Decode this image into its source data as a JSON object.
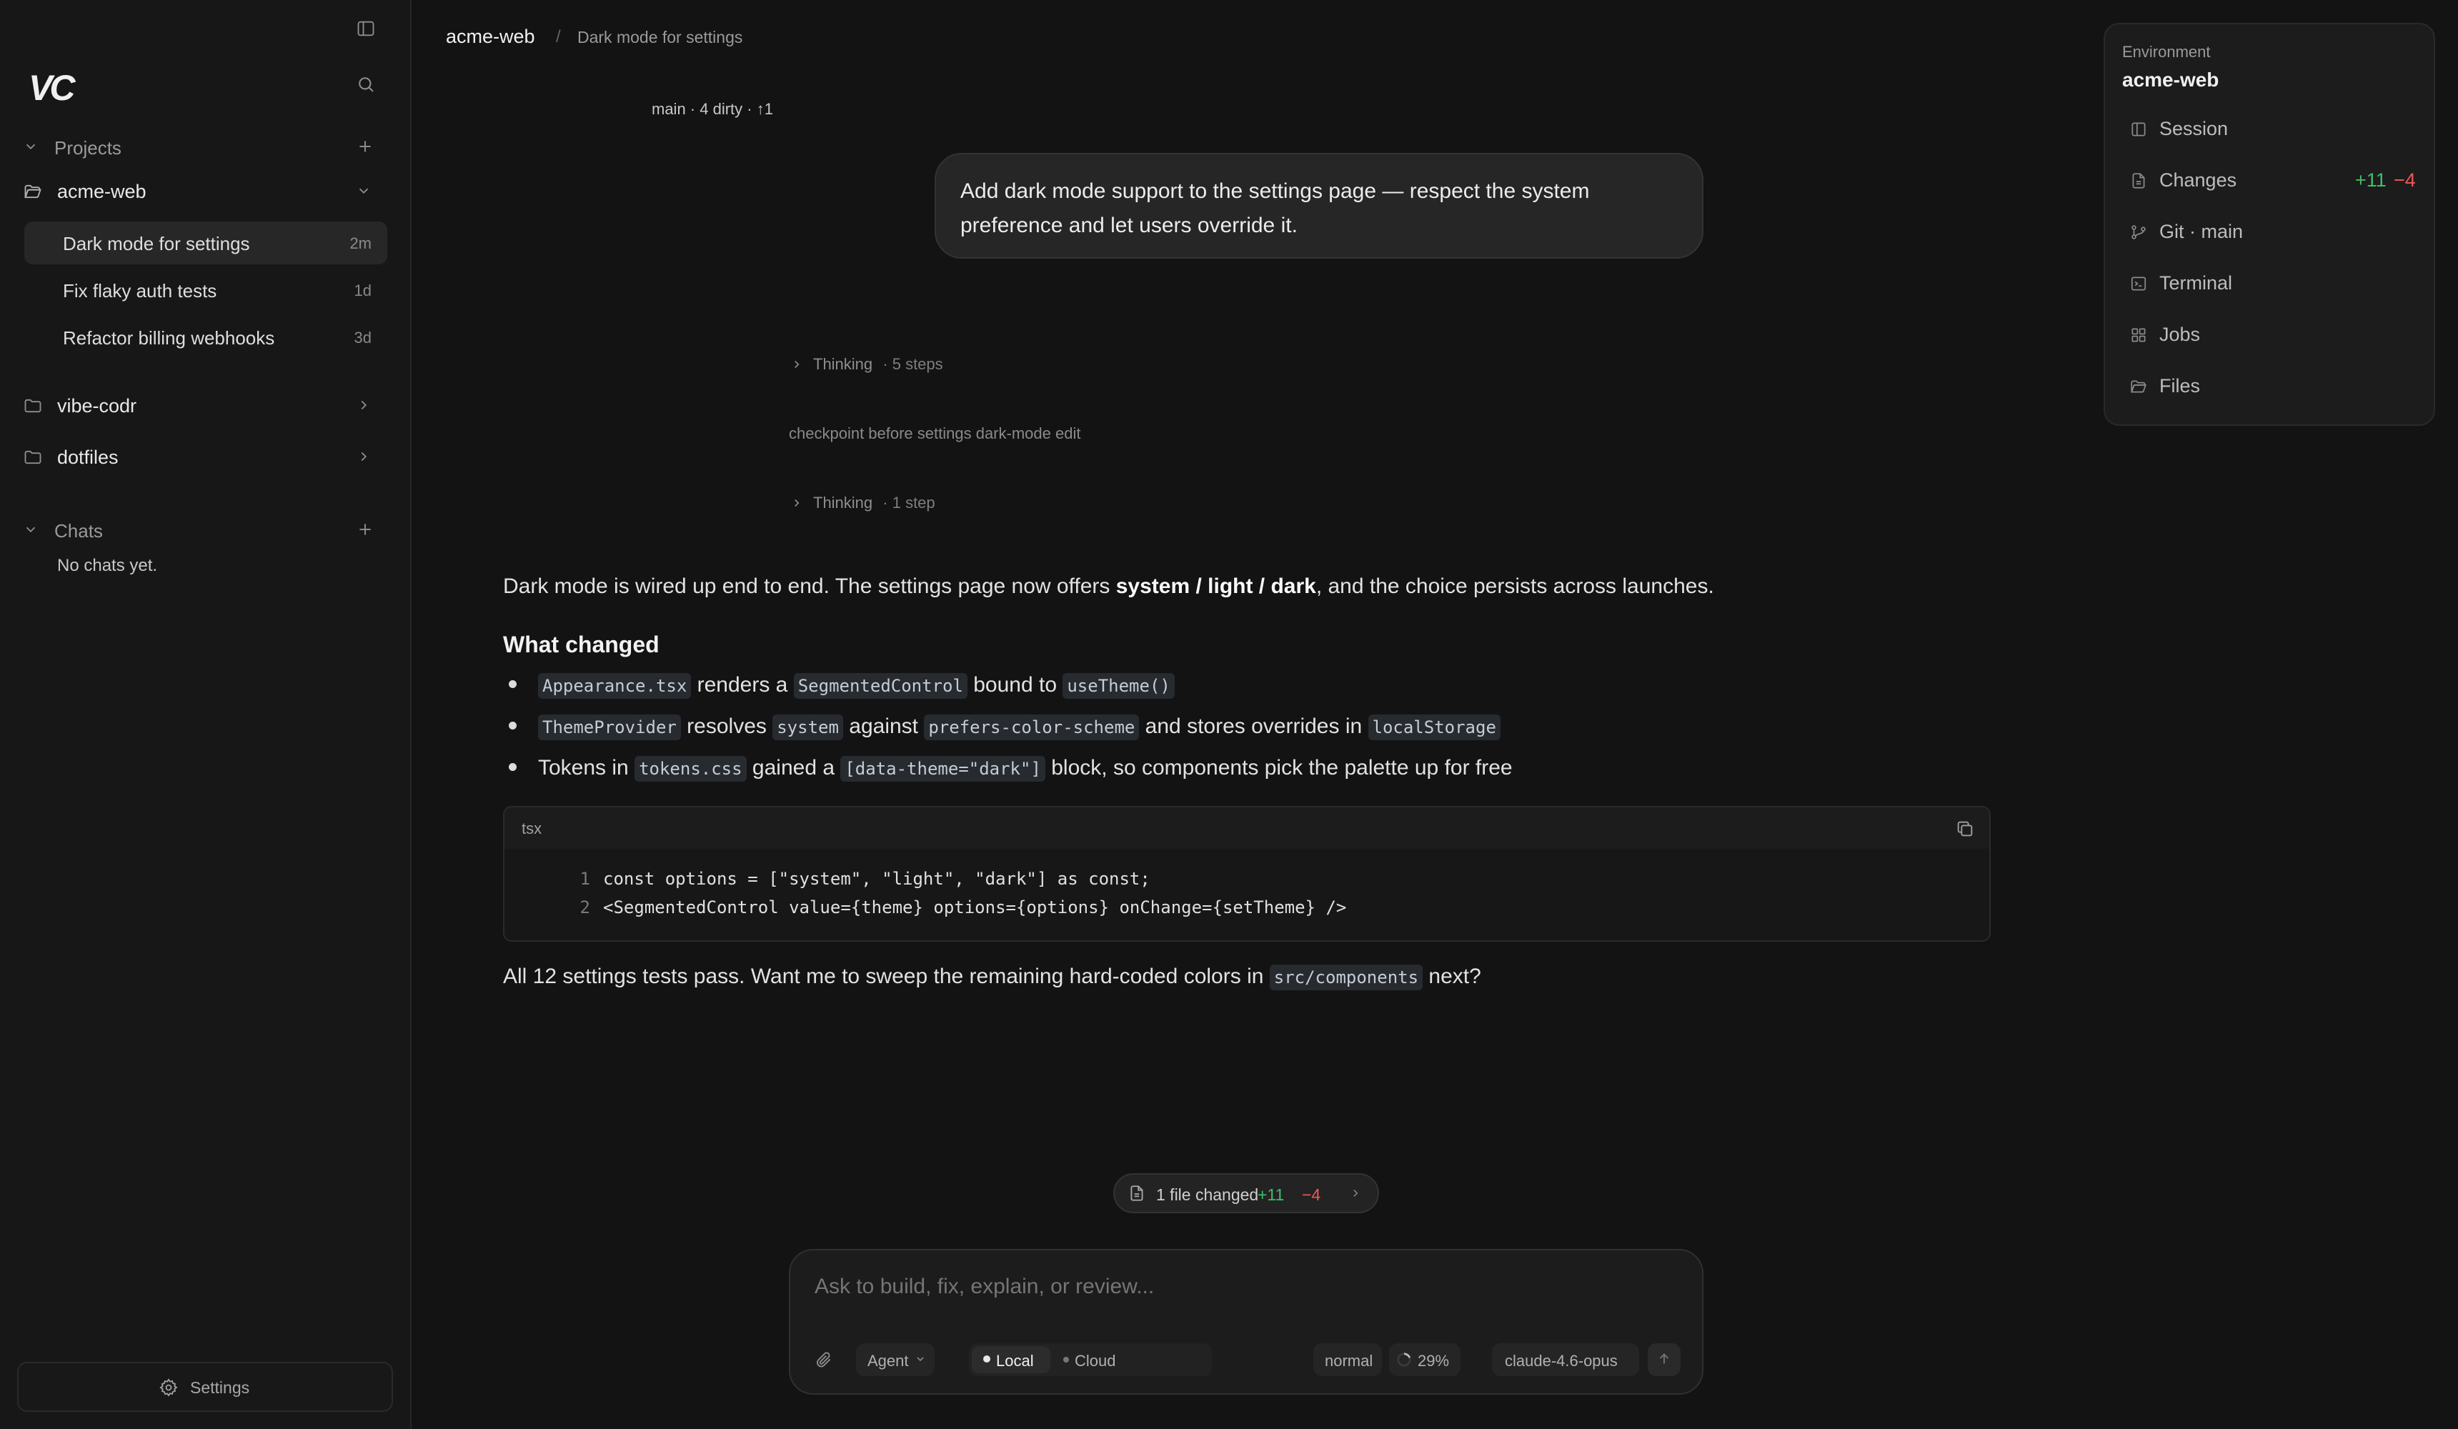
{
  "sidebar": {
    "logo": "VC",
    "projects_label": "Projects",
    "projects": [
      {
        "name": "acme-web",
        "threads": [
          {
            "title": "Dark mode for settings",
            "age": "2m"
          },
          {
            "title": "Fix flaky auth tests",
            "age": "1d"
          },
          {
            "title": "Refactor billing webhooks",
            "age": "3d"
          }
        ]
      },
      {
        "name": "vibe-codr"
      },
      {
        "name": "dotfiles"
      }
    ],
    "chats_label": "Chats",
    "chats_empty": "No chats yet.",
    "settings_label": "Settings"
  },
  "header": {
    "project": "acme-web",
    "separator": "/",
    "thread": "Dark mode for settings"
  },
  "branch_status": "main · 4 dirty · ↑1",
  "conversation": {
    "user_message": "Add dark mode support to the settings page — respect the system preference and let users override it.",
    "thinking_1": {
      "label": "Thinking",
      "steps": "· 5 steps"
    },
    "checkpoint": "checkpoint before settings dark-mode edit",
    "thinking_2": {
      "label": "Thinking",
      "steps": "· 1 step"
    },
    "answer": {
      "intro_pre": "Dark mode is wired up end to end. The settings page now offers ",
      "intro_bold": "system / light / dark",
      "intro_post": ", and the choice persists across launches.",
      "heading": "What changed",
      "bullets": [
        {
          "c1": "Appearance.tsx",
          "t1": " renders a ",
          "c2": "SegmentedControl",
          "t2": " bound to ",
          "c3": "useTheme()"
        },
        {
          "c1": "ThemeProvider",
          "t1": " resolves ",
          "c2": "system",
          "t2": " against ",
          "c3": "prefers-color-scheme",
          "t3": " and stores overrides in ",
          "c4": "localStorage"
        },
        {
          "t0": "Tokens in ",
          "c1": "tokens.css",
          "t1": " gained a ",
          "c2": "[data-theme=\"dark\"]",
          "t2": " block, so components pick the palette up for free"
        }
      ],
      "code": {
        "lang": "tsx",
        "lines": [
          {
            "n": "1",
            "text": "const options = [\"system\", \"light\", \"dark\"] as const;"
          },
          {
            "n": "2",
            "text": "<SegmentedControl value={theme} options={options} onChange={setTheme} />"
          }
        ]
      },
      "outro_pre": "All 12 settings tests pass. Want me to sweep the remaining hard-coded colors in ",
      "outro_code": "src/components",
      "outro_post": " next?"
    }
  },
  "files_changed": {
    "label": "1 file changed",
    "plus": "+11",
    "minus": "−4"
  },
  "composer": {
    "placeholder": "Ask to build, fix, explain, or review...",
    "mode": "Agent",
    "env_local": "Local",
    "env_cloud": "Cloud",
    "effort": "normal",
    "context": "29%",
    "model": "claude-4.6-opus"
  },
  "environment": {
    "label": "Environment",
    "name": "acme-web",
    "items": [
      {
        "label": "Session",
        "icon": "panel-icon"
      },
      {
        "label": "Changes",
        "icon": "file-icon",
        "plus": "+11",
        "minus": "−4"
      },
      {
        "label": "Git · main",
        "icon": "git-branch-icon"
      },
      {
        "label": "Terminal",
        "icon": "terminal-icon"
      },
      {
        "label": "Jobs",
        "icon": "grid-icon"
      },
      {
        "label": "Files",
        "icon": "folder-open-icon"
      }
    ]
  },
  "colors": {
    "accent_plus": "#3fbf6a",
    "accent_minus": "#ef5858",
    "bg": "#131313"
  }
}
